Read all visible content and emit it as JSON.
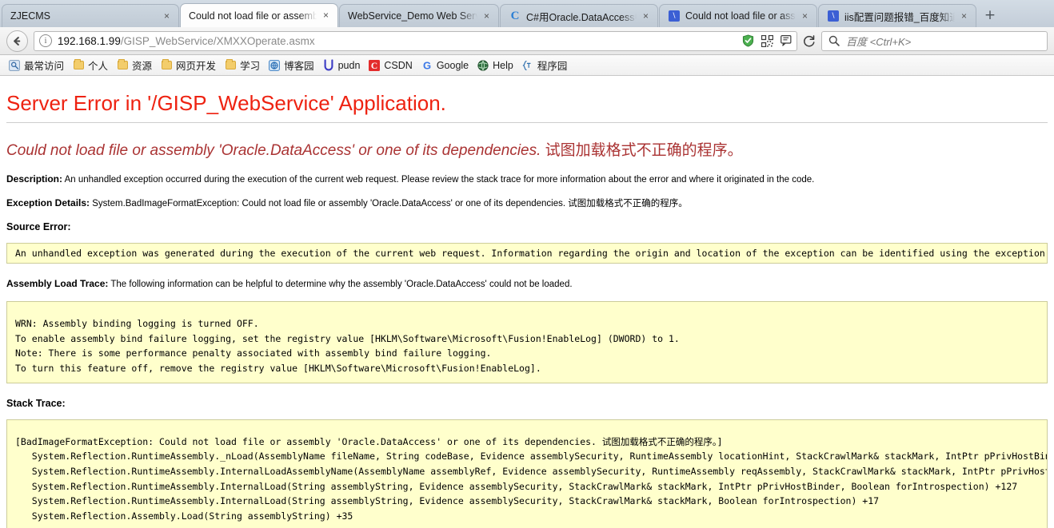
{
  "browser": {
    "tabs": [
      {
        "title": "ZJECMS",
        "favicon": "none",
        "active": false,
        "close_label": "×"
      },
      {
        "title": "Could not load file or assembl",
        "favicon": "none",
        "active": true,
        "close_label": "×"
      },
      {
        "title": "WebService_Demo Web Servic",
        "favicon": "none",
        "active": false,
        "close_label": "×"
      },
      {
        "title": "C#用Oracle.DataAccess中文",
        "favicon": "csdn-icon",
        "active": false,
        "close_label": "×"
      },
      {
        "title": "Could not load file or asse",
        "favicon": "baidu-icon",
        "active": false,
        "close_label": "×"
      },
      {
        "title": "iis配置问题报错_百度知道",
        "favicon": "baidu-icon",
        "active": false,
        "close_label": "×"
      }
    ],
    "new_tab_label": "+",
    "back_icon": "back-arrow-icon",
    "site_info_icon": "info-icon",
    "url": {
      "host": "192.168.1.99",
      "path": "/GISP_WebService/XMXXOperate.asmx"
    },
    "url_icons": [
      "shield-icon",
      "qrcode-icon",
      "screenshot-icon"
    ],
    "reload_icon": "reload-icon",
    "search": {
      "icon": "search-icon",
      "placeholder": "百度 <Ctrl+K>"
    },
    "bookmarks": [
      {
        "label": "最常访问",
        "icon": "most-visited-icon"
      },
      {
        "label": "个人",
        "icon": "folder-icon"
      },
      {
        "label": "资源",
        "icon": "folder-icon"
      },
      {
        "label": "网页开发",
        "icon": "folder-icon"
      },
      {
        "label": "学习",
        "icon": "folder-icon"
      },
      {
        "label": "博客园",
        "icon": "cnblogs-icon"
      },
      {
        "label": "pudn",
        "icon": "pudn-icon"
      },
      {
        "label": "CSDN",
        "icon": "csdn-red-icon"
      },
      {
        "label": "Google",
        "icon": "google-icon"
      },
      {
        "label": "Help",
        "icon": "help-globe-icon"
      },
      {
        "label": "程序园",
        "icon": "chengxuyuan-icon"
      }
    ]
  },
  "page": {
    "heading": "Server Error in '/GISP_WebService' Application.",
    "subheading_en": "Could not load file or assembly 'Oracle.DataAccess' or one of its dependencies. ",
    "subheading_cn": "试图加载格式不正确的程序。",
    "description_label": "Description:",
    "description_text": " An unhandled exception occurred during the execution of the current web request. Please review the stack trace for more information about the error and where it originated in the code.",
    "exception_label": "Exception Details:",
    "exception_text": " System.BadImageFormatException: Could not load file or assembly 'Oracle.DataAccess' or one of its dependencies. 试图加载格式不正确的程序。",
    "source_error_title": "Source Error:",
    "source_error_body": "An unhandled exception was generated during the execution of the current web request. Information regarding the origin and location of the exception can be identified using the exception stack trace below.",
    "assembly_trace_label": "Assembly Load Trace:",
    "assembly_trace_text": " The following information can be helpful to determine why the assembly 'Oracle.DataAccess' could not be loaded.",
    "assembly_trace_body": "WRN: Assembly binding logging is turned OFF.\nTo enable assembly bind failure logging, set the registry value [HKLM\\Software\\Microsoft\\Fusion!EnableLog] (DWORD) to 1.\nNote: There is some performance penalty associated with assembly bind failure logging.\nTo turn this feature off, remove the registry value [HKLM\\Software\\Microsoft\\Fusion!EnableLog].",
    "stack_trace_title": "Stack Trace:",
    "stack_trace_body": "[BadImageFormatException: Could not load file or assembly 'Oracle.DataAccess' or one of its dependencies. 试图加载格式不正确的程序。]\n   System.Reflection.RuntimeAssembly._nLoad(AssemblyName fileName, String codeBase, Evidence assemblySecurity, RuntimeAssembly locationHint, StackCrawlMark& stackMark, IntPtr pPrivHostBinder, Boolean throwOnFileNotFound, Boolean forIntrospection, Boolean suppressSecurityChecks) +0\n   System.Reflection.RuntimeAssembly.InternalLoadAssemblyName(AssemblyName assemblyRef, Evidence assemblySecurity, RuntimeAssembly reqAssembly, StackCrawlMark& stackMark, IntPtr pPrivHostBinder, Boolean throwOnFileNotFound, Boolean forIntrospection, Boolean suppressSecurityChecks) +561\n   System.Reflection.RuntimeAssembly.InternalLoad(String assemblyString, Evidence assemblySecurity, StackCrawlMark& stackMark, IntPtr pPrivHostBinder, Boolean forIntrospection) +127\n   System.Reflection.RuntimeAssembly.InternalLoad(String assemblyString, Evidence assemblySecurity, StackCrawlMark& stackMark, Boolean forIntrospection) +17\n   System.Reflection.Assembly.Load(String assemblyString) +35"
  },
  "colors": {
    "error_red": "#ee2211",
    "error_maroon": "#aa3333",
    "code_bg": "#ffffcc",
    "code_border": "#cccc99"
  }
}
